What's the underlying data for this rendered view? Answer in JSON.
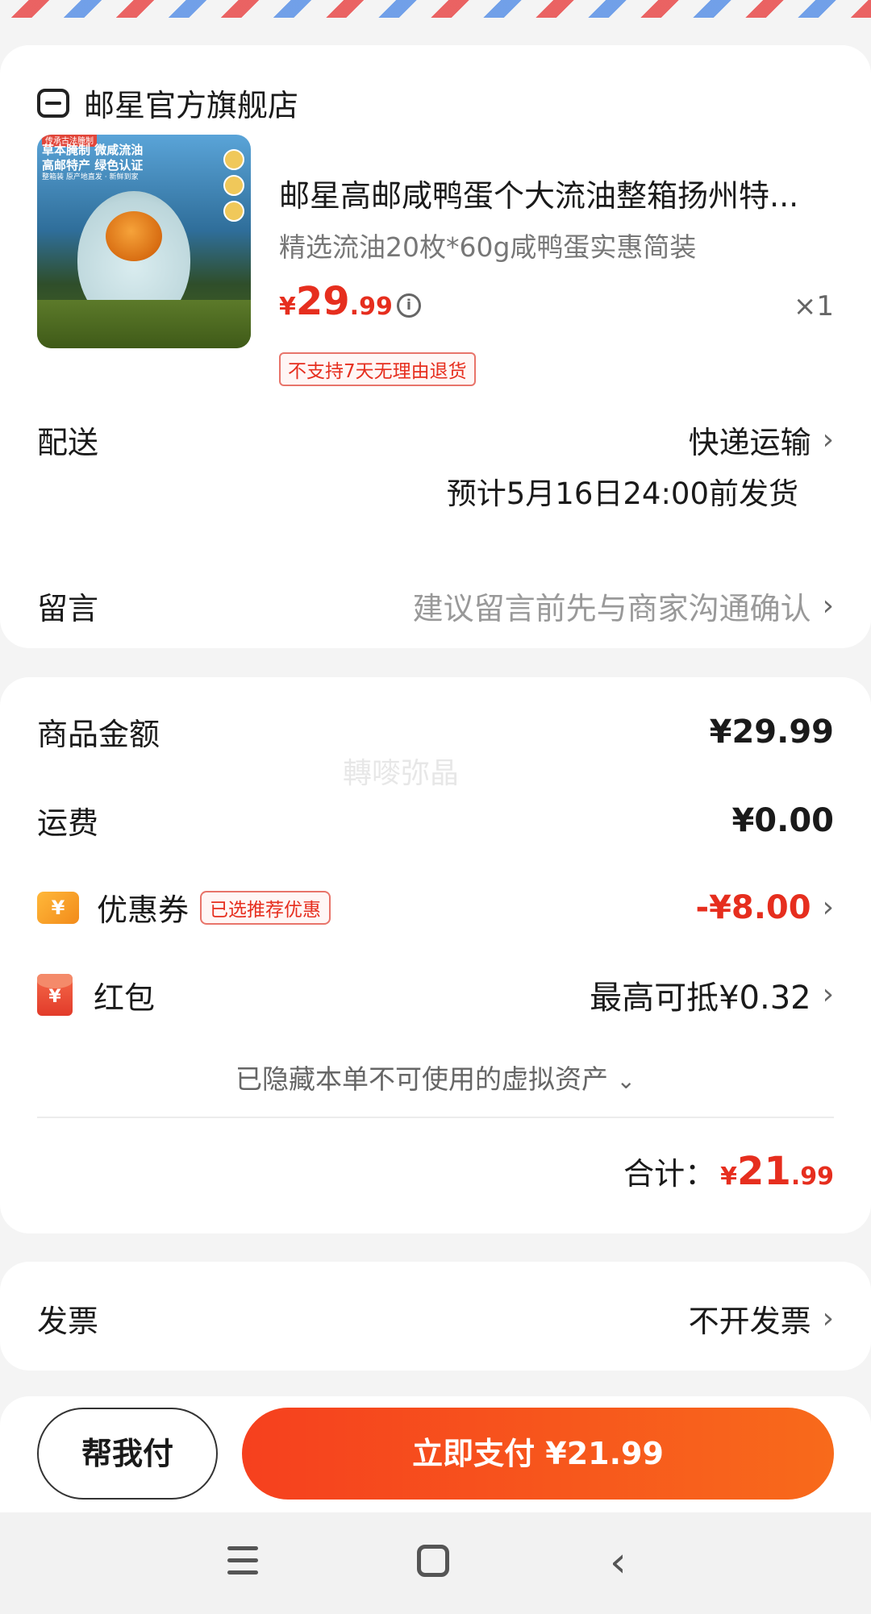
{
  "store": {
    "name": "邮星官方旗舰店"
  },
  "product": {
    "title": "邮星高邮咸鸭蛋个大流油整箱扬州特...",
    "spec": "精选流油20枚*60g咸鸭蛋实惠简装",
    "price_currency": "¥",
    "price_int": "29",
    "price_dec": ".99",
    "quantity": "×1",
    "return_tag": "不支持7天无理由退货",
    "image_text": {
      "top_tag": "传承古法腌制",
      "line1": "草本腌制 微咸流油",
      "line2": "高邮特产 绿色认证",
      "line3": "整箱装 原产地直发 · 新鲜到家"
    }
  },
  "delivery": {
    "label": "配送",
    "method": "快递运输",
    "eta": "预计5月16日24:00前发货"
  },
  "message": {
    "label": "留言",
    "hint": "建议留言前先与商家沟通确认"
  },
  "summary": {
    "goods_label": "商品金额",
    "goods_amount": "¥29.99",
    "shipping_label": "运费",
    "shipping_amount": "¥0.00",
    "coupon_label": "优惠券",
    "coupon_chip": "已选推荐优惠",
    "coupon_amount": "-¥8.00",
    "redpacket_label": "红包",
    "redpacket_amount": "最高可抵¥0.32",
    "hidden_note": "已隐藏本单不可使用的虚拟资产",
    "total_label": "合计：",
    "total_currency": "¥",
    "total_int": "21",
    "total_dec": ".99",
    "watermark": "轉嘜弥晶"
  },
  "invoice": {
    "label": "发票",
    "value": "不开发票"
  },
  "actions": {
    "help_pay": "帮我付",
    "pay_now": "立即支付 ¥21.99"
  },
  "colors": {
    "accent": "#e62e1e",
    "pay_gradient_start": "#f6401e",
    "pay_gradient_end": "#f86a1b"
  }
}
